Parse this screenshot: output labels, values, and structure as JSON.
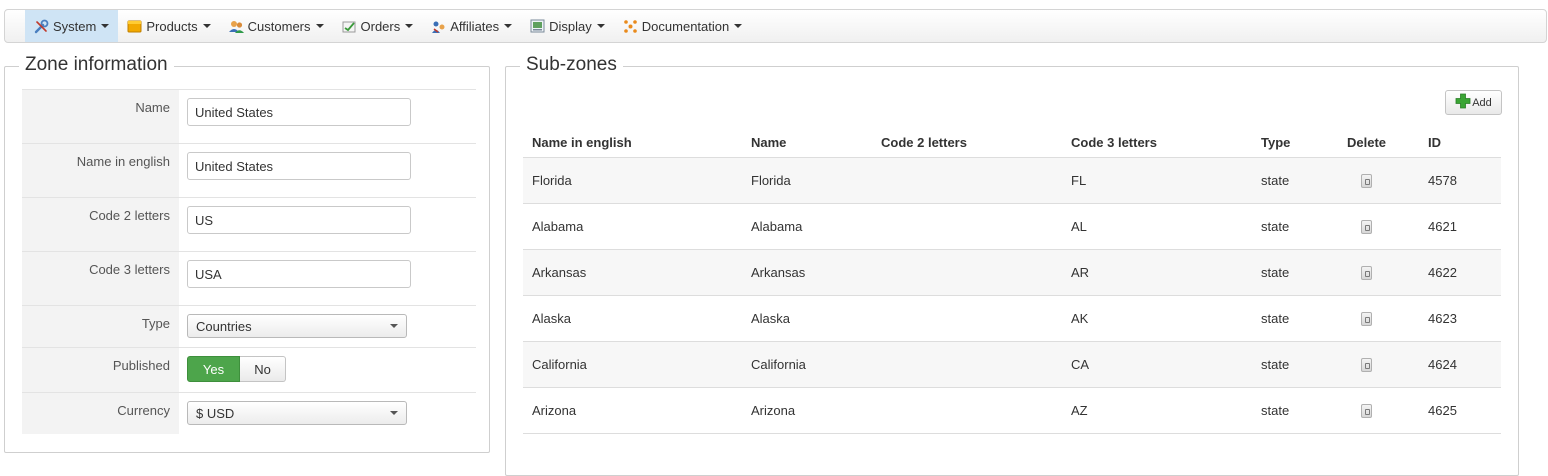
{
  "menu": [
    {
      "label": "System",
      "icon": "wrench-icon",
      "active": true
    },
    {
      "label": "Products",
      "icon": "box-icon",
      "active": false
    },
    {
      "label": "Customers",
      "icon": "users-icon",
      "active": false
    },
    {
      "label": "Orders",
      "icon": "orders-icon",
      "active": false
    },
    {
      "label": "Affiliates",
      "icon": "affiliates-icon",
      "active": false
    },
    {
      "label": "Display",
      "icon": "display-icon",
      "active": false
    },
    {
      "label": "Documentation",
      "icon": "documentation-icon",
      "active": false
    }
  ],
  "zone_info": {
    "legend": "Zone information",
    "name_label": "Name",
    "name_value": "United States",
    "name_english_label": "Name in english",
    "name_english_value": "United States",
    "code2_label": "Code 2 letters",
    "code2_value": "US",
    "code3_label": "Code 3 letters",
    "code3_value": "USA",
    "type_label": "Type",
    "type_value": "Countries",
    "published_label": "Published",
    "published_yes": "Yes",
    "published_no": "No",
    "published_state": "Yes",
    "currency_label": "Currency",
    "currency_value": "$ USD"
  },
  "subzones": {
    "legend": "Sub-zones",
    "add_label": "Add",
    "columns": [
      "Name in english",
      "Name",
      "Code 2 letters",
      "Code 3 letters",
      "Type",
      "Delete",
      "ID"
    ],
    "rows": [
      {
        "name_en": "Florida",
        "name": "Florida",
        "code2": "",
        "code3": "FL",
        "type": "state",
        "id": "4578"
      },
      {
        "name_en": "Alabama",
        "name": "Alabama",
        "code2": "",
        "code3": "AL",
        "type": "state",
        "id": "4621"
      },
      {
        "name_en": "Arkansas",
        "name": "Arkansas",
        "code2": "",
        "code3": "AR",
        "type": "state",
        "id": "4622"
      },
      {
        "name_en": "Alaska",
        "name": "Alaska",
        "code2": "",
        "code3": "AK",
        "type": "state",
        "id": "4623"
      },
      {
        "name_en": "California",
        "name": "California",
        "code2": "",
        "code3": "CA",
        "type": "state",
        "id": "4624"
      },
      {
        "name_en": "Arizona",
        "name": "Arizona",
        "code2": "",
        "code3": "AZ",
        "type": "state",
        "id": "4625"
      }
    ]
  },
  "colors": {
    "active_menu": "#cfe4f5",
    "yes_button": "#4da54b",
    "add_icon": "#3aa534"
  }
}
